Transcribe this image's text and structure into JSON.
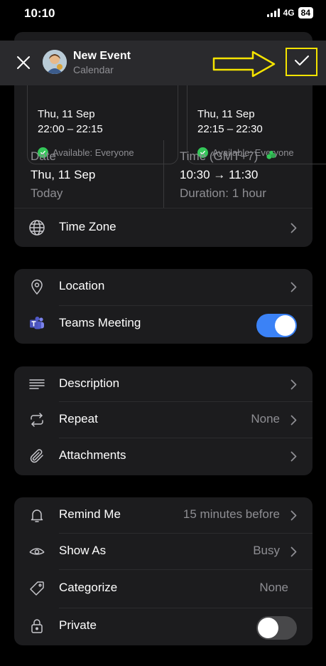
{
  "status_bar": {
    "time": "10:10",
    "network": "4G",
    "battery": "84"
  },
  "header": {
    "title": "New Event",
    "subtitle": "Calendar"
  },
  "slots": [
    {
      "date": "Thu, 11 Sep",
      "time": "22:00 – 22:15",
      "availability": "Available: Everyone"
    },
    {
      "date": "Thu, 11 Sep",
      "time": "22:15 – 22:30",
      "availability": "Available: Everyone"
    }
  ],
  "date_section": {
    "label": "Date",
    "value": "Thu, 11 Sep",
    "sub": "Today"
  },
  "time_section": {
    "label": "Time (GMT+7)",
    "value": "10:30 → 11:30",
    "sub": "Duration: 1 hour"
  },
  "rows": {
    "time_zone": "Time Zone",
    "location": "Location",
    "teams_meeting": "Teams Meeting",
    "description": "Description",
    "repeat": "Repeat",
    "repeat_value": "None",
    "attachments": "Attachments",
    "remind_me": "Remind Me",
    "remind_value": "15 minutes before",
    "show_as": "Show As",
    "show_as_value": "Busy",
    "categorize": "Categorize",
    "categorize_value": "None",
    "private": "Private"
  },
  "toggles": {
    "teams_meeting": true,
    "private": false
  },
  "colors": {
    "accent": "#3b82f6",
    "annotation": "#f5e400",
    "available": "#34c759",
    "card": "#1c1c1e"
  },
  "icons": {
    "close": "close-icon",
    "confirm": "checkmark-icon",
    "globe": "globe-icon",
    "location": "location-pin-icon",
    "teams": "teams-icon",
    "description": "lines-icon",
    "repeat": "repeat-icon",
    "attachments": "paperclip-icon",
    "remind": "bell-icon",
    "show_as": "eye-icon",
    "categorize": "tag-icon",
    "private": "lock-icon"
  }
}
